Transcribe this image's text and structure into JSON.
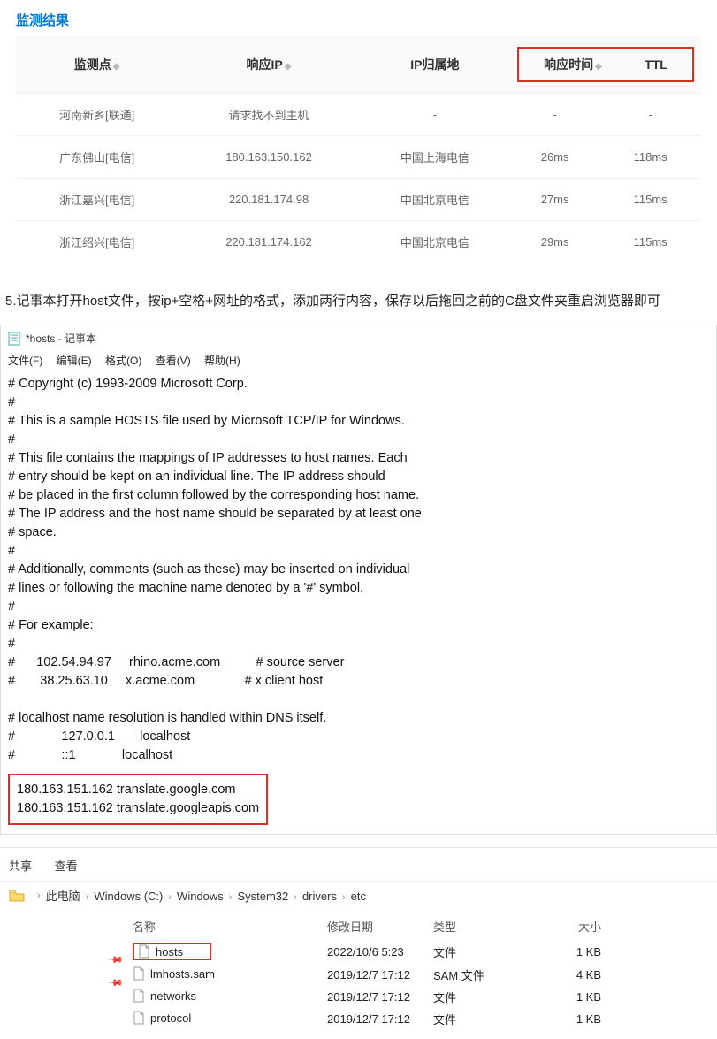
{
  "title": "监测结果",
  "table": {
    "headers": {
      "node": "监测点",
      "ip": "响应IP",
      "location": "IP归属地",
      "time": "响应时间",
      "ttl": "TTL"
    },
    "rows": [
      {
        "node": "河南新乡[联通]",
        "ip": "请求找不到主机",
        "ip_err": true,
        "loc": "-",
        "time": "-",
        "ttl": "-"
      },
      {
        "node": "广东佛山[电信]",
        "ip": "180.163.150.162",
        "loc": "中国上海电信",
        "time": "26ms",
        "ttl": "118ms"
      },
      {
        "node": "浙江嘉兴[电信]",
        "ip": "220.181.174.98",
        "loc": "中国北京电信",
        "time": "27ms",
        "ttl": "115ms"
      },
      {
        "node": "浙江绍兴[电信]",
        "ip": "220.181.174.162",
        "loc": "中国北京电信",
        "time": "29ms",
        "ttl": "115ms"
      }
    ]
  },
  "step5": "5.记事本打开host文件，按ip+空格+网址的格式，添加两行内容，保存以后拖回之前的C盘文件夹重启浏览器即可",
  "notepad": {
    "title": "*hosts - 记事本",
    "menu": {
      "file": "文件(F)",
      "edit": "编辑(E)",
      "format": "格式(O)",
      "view": "查看(V)",
      "help": "帮助(H)"
    },
    "body_lines": [
      "# Copyright (c) 1993-2009 Microsoft Corp.",
      "#",
      "# This is a sample HOSTS file used by Microsoft TCP/IP for Windows.",
      "#",
      "# This file contains the mappings of IP addresses to host names. Each",
      "# entry should be kept on an individual line. The IP address should",
      "# be placed in the first column followed by the corresponding host name.",
      "# The IP address and the host name should be separated by at least one",
      "# space.",
      "#",
      "# Additionally, comments (such as these) may be inserted on individual",
      "# lines or following the machine name denoted by a '#' symbol.",
      "#",
      "# For example:",
      "#",
      "#      102.54.94.97     rhino.acme.com          # source server",
      "#       38.25.63.10     x.acme.com              # x client host",
      "",
      "# localhost name resolution is handled within DNS itself.",
      "#             127.0.0.1       localhost",
      "#             ::1             localhost"
    ],
    "added": "180.163.151.162 translate.google.com\n180.163.151.162 translate.googleapis.com"
  },
  "explorer": {
    "toolbar": {
      "share": "共享",
      "view": "查看"
    },
    "path": [
      "此电脑",
      "Windows (C:)",
      "Windows",
      "System32",
      "drivers",
      "etc"
    ],
    "columns": {
      "name": "名称",
      "date": "修改日期",
      "type": "类型",
      "size": "大小"
    },
    "files": [
      {
        "name": "hosts",
        "date": "2022/10/6 5:23",
        "type": "文件",
        "size": "1 KB",
        "highlight": true,
        "pin": true
      },
      {
        "name": "lmhosts.sam",
        "date": "2019/12/7 17:12",
        "type": "SAM 文件",
        "size": "4 KB",
        "pin": true
      },
      {
        "name": "networks",
        "date": "2019/12/7 17:12",
        "type": "文件",
        "size": "1 KB"
      },
      {
        "name": "protocol",
        "date": "2019/12/7 17:12",
        "type": "文件",
        "size": "1 KB"
      }
    ]
  }
}
